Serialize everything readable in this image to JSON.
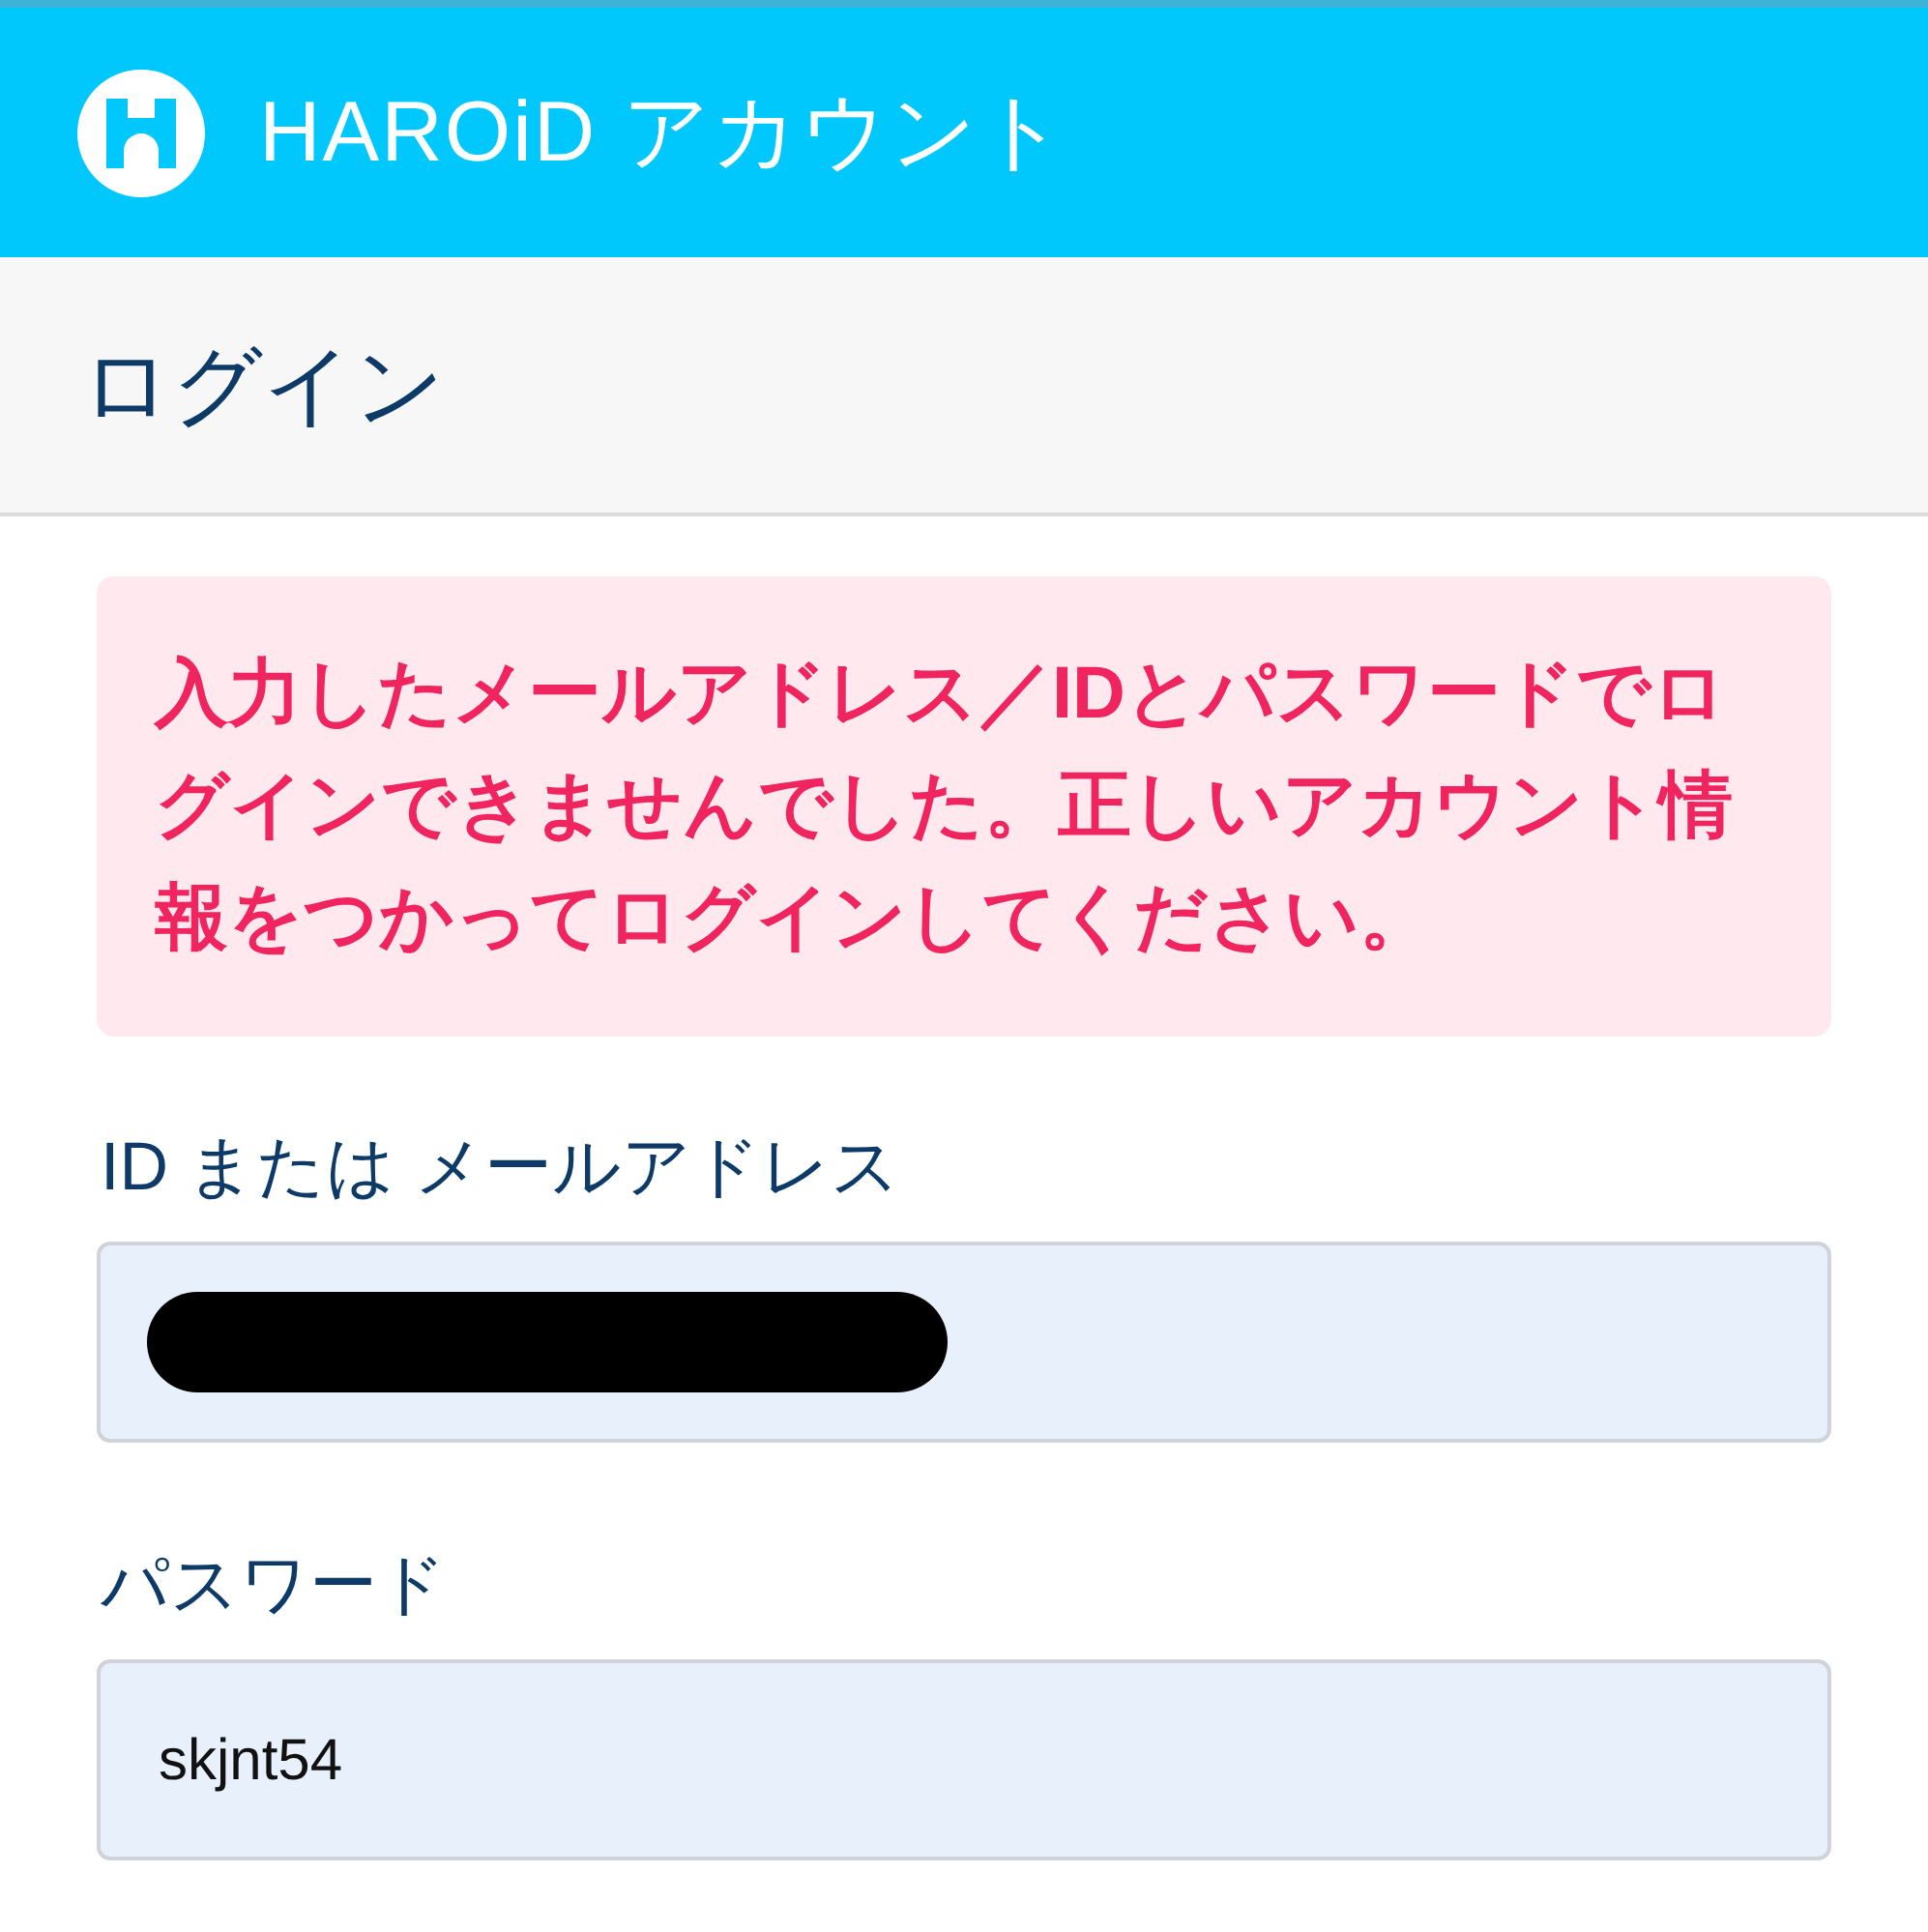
{
  "header": {
    "title": "HAROiD アカウント"
  },
  "page": {
    "title": "ログイン"
  },
  "error": {
    "message": "入力したメールアドレス／IDとパスワードでログインできませんでした。正しいアカウント情報をつかってログインしてください。"
  },
  "fields": [
    {
      "label": "ID または メールアドレス",
      "redacted": true
    },
    {
      "label": "パスワード",
      "value": "skjnt54",
      "redacted": false
    }
  ]
}
